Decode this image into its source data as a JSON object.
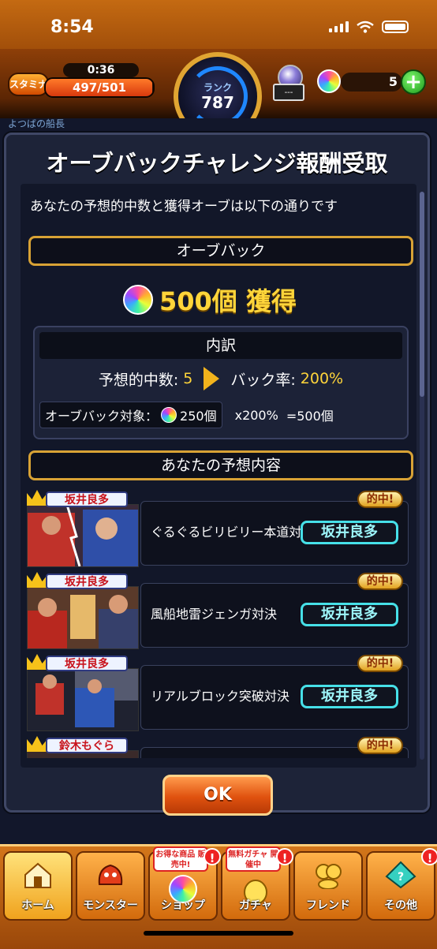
{
  "status_bar": {
    "time": "8:54"
  },
  "top_bar": {
    "stamina_label": "スタミナ",
    "stamina_timer": "0:36",
    "stamina_value": "497/501",
    "rank_label": "ランク",
    "rank_value": "787",
    "gacha_box_label": "---",
    "orb_count": "5",
    "plus_label": "+",
    "background_crumb": "よつばの船長"
  },
  "dialog": {
    "title": "オーブバックチャレンジ報酬受取",
    "intro": "あなたの予想的中数と獲得オーブは以下の通りです",
    "orbback_header": "オーブバック",
    "result_text": "500個 獲得",
    "breakdown": {
      "header": "内訳",
      "hits_label": "予想的中数:",
      "hits_value": "5",
      "rate_label": "バック率:",
      "rate_value": "200%",
      "target_label": "オーブバック対象：",
      "target_value": "250個",
      "multiplier": "x200%",
      "total": "=500個"
    },
    "predictions_header": "あなたの予想内容",
    "predictions": [
      {
        "winner_tag": "坂井良多",
        "hit_badge": "的中!",
        "event": "ぐるぐるビリビリー本道対決",
        "pick": "坂井良多"
      },
      {
        "winner_tag": "坂井良多",
        "hit_badge": "的中!",
        "event": "風船地雷ジェンガ対決",
        "pick": "坂井良多"
      },
      {
        "winner_tag": "坂井良多",
        "hit_badge": "的中!",
        "event": "リアルブロック突破対決",
        "pick": "坂井良多"
      },
      {
        "winner_tag": "鈴木もぐら",
        "hit_badge": "的中!",
        "event": "",
        "pick": ""
      }
    ],
    "ok_label": "OK"
  },
  "bottom_nav": {
    "items": [
      {
        "label": "ホーム"
      },
      {
        "label": "モンスター"
      },
      {
        "label": "ショップ",
        "badge": "お得な商品 販売中!"
      },
      {
        "label": "ガチャ",
        "badge": "無料ガチャ 開催中"
      },
      {
        "label": "フレンド"
      },
      {
        "label": "その他"
      }
    ],
    "alert_mark": "!"
  },
  "colors": {
    "accent_gold": "#d8a235",
    "highlight_yellow": "#ffd53a",
    "pick_cyan": "#46e0e8",
    "nav_orange": "#d3761a"
  }
}
